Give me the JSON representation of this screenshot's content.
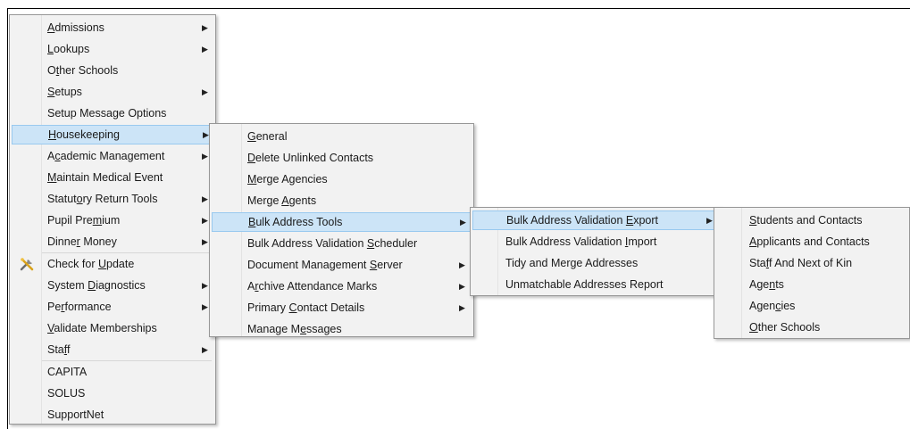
{
  "menu1": {
    "items": [
      {
        "before": "",
        "u": "A",
        "after": "dmissions",
        "arrow": true
      },
      {
        "before": "",
        "u": "L",
        "after": "ookups",
        "arrow": true
      },
      {
        "before": "O",
        "u": "t",
        "after": "her Schools",
        "arrow": false
      },
      {
        "before": "",
        "u": "S",
        "after": "etups",
        "arrow": true
      },
      {
        "before": "Setup Message Options",
        "u": "",
        "after": "",
        "arrow": false
      },
      {
        "before": "",
        "u": "H",
        "after": "ousekeeping",
        "arrow": true
      },
      {
        "before": "A",
        "u": "c",
        "after": "ademic Management",
        "arrow": true
      },
      {
        "before": "",
        "u": "M",
        "after": "aintain Medical Event",
        "arrow": false
      },
      {
        "before": "Statut",
        "u": "o",
        "after": "ry Return Tools",
        "arrow": true
      },
      {
        "before": "Pupil Pre",
        "u": "m",
        "after": "ium",
        "arrow": true
      },
      {
        "before": "Dinne",
        "u": "r",
        "after": " Money",
        "arrow": true
      },
      {
        "before": "Check for ",
        "u": "U",
        "after": "pdate",
        "arrow": false
      },
      {
        "before": "System ",
        "u": "D",
        "after": "iagnostics",
        "arrow": true
      },
      {
        "before": "Pe",
        "u": "r",
        "after": "formance",
        "arrow": true
      },
      {
        "before": "",
        "u": "V",
        "after": "alidate Memberships",
        "arrow": false
      },
      {
        "before": "Sta",
        "u": "f",
        "after": "f",
        "arrow": true
      },
      {
        "before": "CAPITA",
        "u": "",
        "after": "",
        "arrow": false
      },
      {
        "before": "SOLUS",
        "u": "",
        "after": "",
        "arrow": false
      },
      {
        "before": "SupportNet",
        "u": "",
        "after": "",
        "arrow": false
      }
    ]
  },
  "menu2": {
    "items": [
      {
        "before": "",
        "u": "G",
        "after": "eneral",
        "arrow": false
      },
      {
        "before": "",
        "u": "D",
        "after": "elete Unlinked Contacts",
        "arrow": false
      },
      {
        "before": "",
        "u": "M",
        "after": "erge Agencies",
        "arrow": false
      },
      {
        "before": "Merge ",
        "u": "A",
        "after": "gents",
        "arrow": false
      },
      {
        "before": "",
        "u": "B",
        "after": "ulk Address Tools",
        "arrow": true
      },
      {
        "before": "Bulk Address Validation ",
        "u": "S",
        "after": "cheduler",
        "arrow": false
      },
      {
        "before": "Document Management ",
        "u": "S",
        "after": "erver",
        "arrow": true
      },
      {
        "before": "A",
        "u": "r",
        "after": "chive Attendance Marks",
        "arrow": true
      },
      {
        "before": "Primary ",
        "u": "C",
        "after": "ontact Details",
        "arrow": true
      },
      {
        "before": "Manage M",
        "u": "e",
        "after": "ssages",
        "arrow": false
      }
    ]
  },
  "menu3": {
    "items": [
      {
        "before": "Bulk Address Validation ",
        "u": "E",
        "after": "xport",
        "arrow": true
      },
      {
        "before": "Bulk Address Validation ",
        "u": "I",
        "after": "mport",
        "arrow": false
      },
      {
        "before": "Tidy and Merge Addresses",
        "u": "",
        "after": "",
        "arrow": false
      },
      {
        "before": "Unmatchable Addresses Report",
        "u": "",
        "after": "",
        "arrow": false
      }
    ]
  },
  "menu4": {
    "items": [
      {
        "before": "",
        "u": "S",
        "after": "tudents and Contacts",
        "arrow": false
      },
      {
        "before": "",
        "u": "A",
        "after": "pplicants and Contacts",
        "arrow": false
      },
      {
        "before": "Sta",
        "u": "f",
        "after": "f And Next of Kin",
        "arrow": false
      },
      {
        "before": "Age",
        "u": "n",
        "after": "ts",
        "arrow": false
      },
      {
        "before": "Agen",
        "u": "c",
        "after": "ies",
        "arrow": false
      },
      {
        "before": "",
        "u": "O",
        "after": "ther Schools",
        "arrow": false
      }
    ]
  },
  "icons": {
    "arrow": "▶",
    "submenu_arrow_highlight": "▶"
  },
  "colors": {
    "menu_bg": "#f2f2f2",
    "highlight_bg": "#cce4f7",
    "highlight_border": "#99c9ef",
    "border": "#979797"
  }
}
